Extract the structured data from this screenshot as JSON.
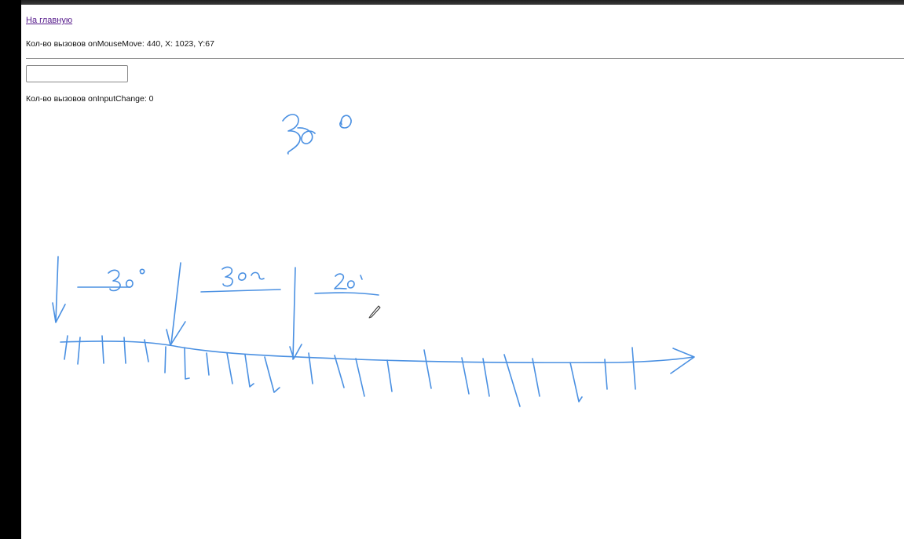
{
  "nav": {
    "home_link": "На главную"
  },
  "mouse": {
    "status_text": "Кол-во вызовов onMouseMove: 440, X: 1023, Y:67"
  },
  "input": {
    "value": "",
    "placeholder": ""
  },
  "input_counter": {
    "status_text": "Кол-во вызовов onInputChange: 0"
  },
  "annotation": {
    "ink_color": "#4a90e2",
    "handwritten_labels": [
      "300",
      "300",
      "300",
      "200"
    ]
  }
}
